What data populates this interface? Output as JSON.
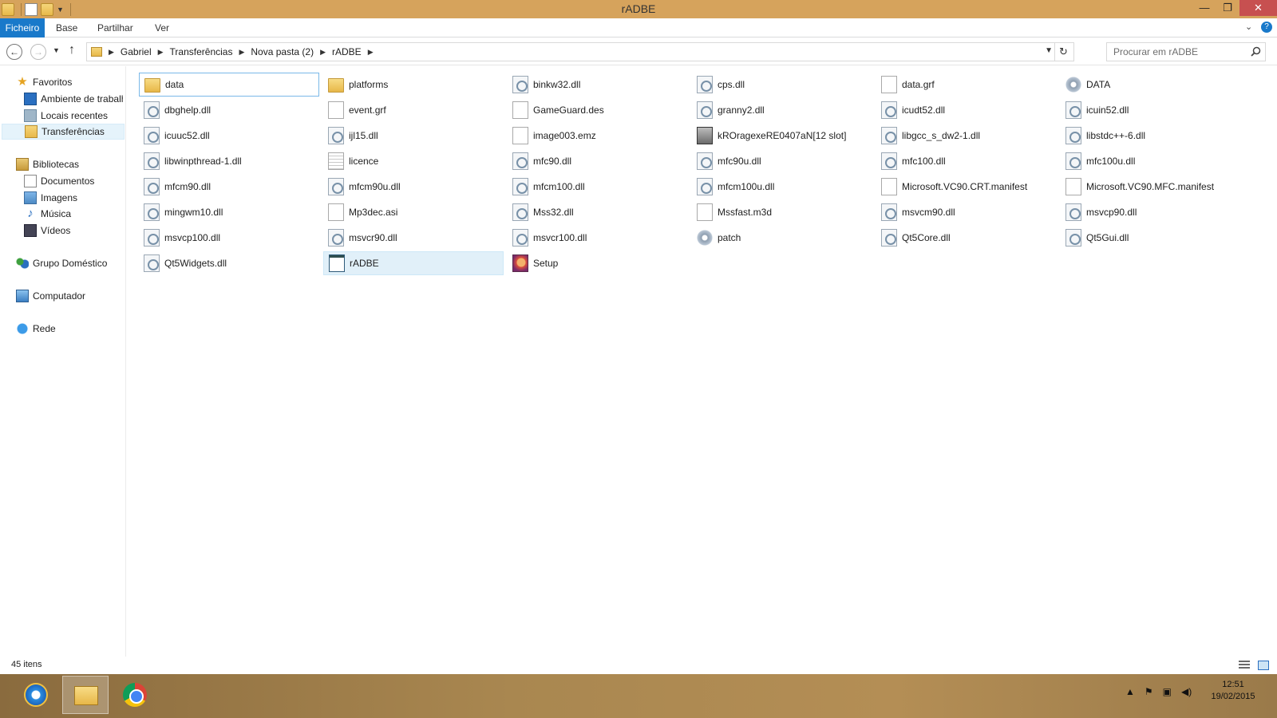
{
  "window": {
    "title": "rADBE",
    "controls": [
      "—",
      "❐",
      "✕"
    ]
  },
  "ribbon": {
    "tabs": [
      "Ficheiro",
      "Base",
      "Partilhar",
      "Ver"
    ]
  },
  "address": {
    "breadcrumb": [
      "Gabriel",
      "Transferências",
      "Nova pasta (2)",
      "rADBE"
    ],
    "search_placeholder": "Procurar em rADBE"
  },
  "navpane": {
    "favorites_label": "Favoritos",
    "favorites": [
      "Ambiente de trabalho",
      "Locais recentes",
      "Transferências"
    ],
    "libraries_label": "Bibliotecas",
    "libraries": [
      "Documentos",
      "Imagens",
      "Música",
      "Vídeos"
    ],
    "homegroup_label": "Grupo Doméstico",
    "computer_label": "Computador",
    "network_label": "Rede"
  },
  "files": [
    {
      "name": "data",
      "icon": "folder-icon"
    },
    {
      "name": "platforms",
      "icon": "folder-icon"
    },
    {
      "name": "binkw32.dll",
      "icon": "dll-icon"
    },
    {
      "name": "cps.dll",
      "icon": "dll-icon"
    },
    {
      "name": "data.grf",
      "icon": "file-icon"
    },
    {
      "name": "DATA",
      "icon": "settings-file-icon"
    },
    {
      "name": "dbghelp.dll",
      "icon": "dll-icon"
    },
    {
      "name": "event.grf",
      "icon": "file-icon"
    },
    {
      "name": "GameGuard.des",
      "icon": "file-icon"
    },
    {
      "name": "granny2.dll",
      "icon": "dll-icon"
    },
    {
      "name": "icudt52.dll",
      "icon": "dll-icon"
    },
    {
      "name": "icuin52.dll",
      "icon": "dll-icon"
    },
    {
      "name": "icuuc52.dll",
      "icon": "dll-icon"
    },
    {
      "name": "ijl15.dll",
      "icon": "dll-icon"
    },
    {
      "name": "image003.emz",
      "icon": "file-icon"
    },
    {
      "name": "kROragexeRE0407aN[12 slot]",
      "icon": "game-app-icon"
    },
    {
      "name": "libgcc_s_dw2-1.dll",
      "icon": "dll-icon"
    },
    {
      "name": "libstdc++-6.dll",
      "icon": "dll-icon"
    },
    {
      "name": "libwinpthread-1.dll",
      "icon": "dll-icon"
    },
    {
      "name": "licence",
      "icon": "text-file-icon"
    },
    {
      "name": "mfc90.dll",
      "icon": "dll-icon"
    },
    {
      "name": "mfc90u.dll",
      "icon": "dll-icon"
    },
    {
      "name": "mfc100.dll",
      "icon": "dll-icon"
    },
    {
      "name": "mfc100u.dll",
      "icon": "dll-icon"
    },
    {
      "name": "mfcm90.dll",
      "icon": "dll-icon"
    },
    {
      "name": "mfcm90u.dll",
      "icon": "dll-icon"
    },
    {
      "name": "mfcm100.dll",
      "icon": "dll-icon"
    },
    {
      "name": "mfcm100u.dll",
      "icon": "dll-icon"
    },
    {
      "name": "Microsoft.VC90.CRT.manifest",
      "icon": "file-icon"
    },
    {
      "name": "Microsoft.VC90.MFC.manifest",
      "icon": "file-icon"
    },
    {
      "name": "mingwm10.dll",
      "icon": "dll-icon"
    },
    {
      "name": "Mp3dec.asi",
      "icon": "file-icon"
    },
    {
      "name": "Mss32.dll",
      "icon": "dll-icon"
    },
    {
      "name": "Mssfast.m3d",
      "icon": "file-icon"
    },
    {
      "name": "msvcm90.dll",
      "icon": "dll-icon"
    },
    {
      "name": "msvcp90.dll",
      "icon": "dll-icon"
    },
    {
      "name": "msvcp100.dll",
      "icon": "dll-icon"
    },
    {
      "name": "msvcr90.dll",
      "icon": "dll-icon"
    },
    {
      "name": "msvcr100.dll",
      "icon": "dll-icon"
    },
    {
      "name": "patch",
      "icon": "settings-file-icon"
    },
    {
      "name": "Qt5Core.dll",
      "icon": "dll-icon"
    },
    {
      "name": "Qt5Gui.dll",
      "icon": "dll-icon"
    },
    {
      "name": "Qt5Widgets.dll",
      "icon": "dll-icon"
    },
    {
      "name": "rADBE",
      "icon": "application-icon"
    },
    {
      "name": "Setup",
      "icon": "setup-app-icon"
    }
  ],
  "status": {
    "item_count": "45 itens"
  },
  "taskbar": {
    "apps": [
      "internet-explorer-icon",
      "file-explorer-icon",
      "chrome-icon"
    ],
    "time": "12:51",
    "date": "19/02/2015"
  },
  "colors": {
    "title_bar": "#d6a35c",
    "file_tab": "#1979ca",
    "selection": "#e1f0f9",
    "close_button": "#c75050"
  }
}
